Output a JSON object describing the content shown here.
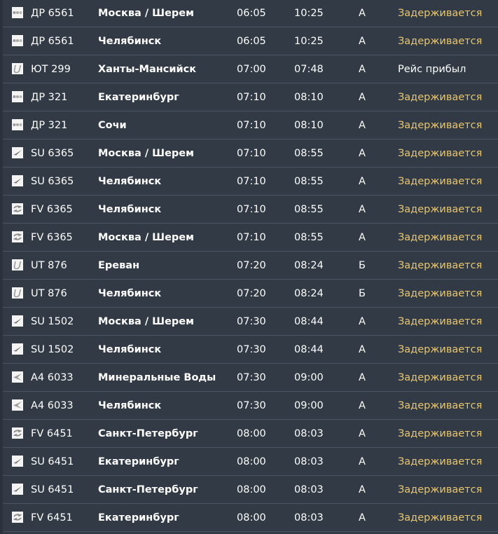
{
  "colors": {
    "background": "#323a45",
    "separator": "#4a5561",
    "text": "#ffffff",
    "status_delayed": "#e8c66e"
  },
  "flights": [
    {
      "airline_icon": "dots-logo-icon",
      "flight": "ДР 6561",
      "destination": "Москва / Шерем",
      "departure": "06:05",
      "arrival": "10:25",
      "terminal": "А",
      "status": "Задерживается",
      "status_type": "delayed"
    },
    {
      "airline_icon": "dots-logo-icon",
      "flight": "ДР 6561",
      "destination": "Челябинск",
      "departure": "06:05",
      "arrival": "10:25",
      "terminal": "А",
      "status": "Задерживается",
      "status_type": "delayed"
    },
    {
      "airline_icon": "u-logo-icon",
      "flight": "ЮТ 299",
      "destination": "Ханты-Мансийск",
      "departure": "07:00",
      "arrival": "07:48",
      "terminal": "А",
      "status": "Рейс прибыл",
      "status_type": "arrived"
    },
    {
      "airline_icon": "dots-logo-icon",
      "flight": "ДР 321",
      "destination": "Екатеринбург",
      "departure": "07:10",
      "arrival": "08:10",
      "terminal": "А",
      "status": "Задерживается",
      "status_type": "delayed"
    },
    {
      "airline_icon": "dots-logo-icon",
      "flight": "ДР 321",
      "destination": "Сочи",
      "departure": "07:10",
      "arrival": "08:10",
      "terminal": "А",
      "status": "Задерживается",
      "status_type": "delayed"
    },
    {
      "airline_icon": "plane-logo-icon",
      "flight": "SU 6365",
      "destination": "Москва / Шерем",
      "departure": "07:10",
      "arrival": "08:55",
      "terminal": "А",
      "status": "Задерживается",
      "status_type": "delayed"
    },
    {
      "airline_icon": "plane-logo-icon",
      "flight": "SU 6365",
      "destination": "Челябинск",
      "departure": "07:10",
      "arrival": "08:55",
      "terminal": "А",
      "status": "Задерживается",
      "status_type": "delayed"
    },
    {
      "airline_icon": "swirl-logo-icon",
      "flight": "FV 6365",
      "destination": "Челябинск",
      "departure": "07:10",
      "arrival": "08:55",
      "terminal": "А",
      "status": "Задерживается",
      "status_type": "delayed"
    },
    {
      "airline_icon": "swirl-logo-icon",
      "flight": "FV 6365",
      "destination": "Москва / Шерем",
      "departure": "07:10",
      "arrival": "08:55",
      "terminal": "А",
      "status": "Задерживается",
      "status_type": "delayed"
    },
    {
      "airline_icon": "u-logo-icon",
      "flight": "UT 876",
      "destination": "Ереван",
      "departure": "07:20",
      "arrival": "08:24",
      "terminal": "Б",
      "status": "Задерживается",
      "status_type": "delayed"
    },
    {
      "airline_icon": "u-logo-icon",
      "flight": "UT 876",
      "destination": "Челябинск",
      "departure": "07:20",
      "arrival": "08:24",
      "terminal": "Б",
      "status": "Задерживается",
      "status_type": "delayed"
    },
    {
      "airline_icon": "plane-logo-icon",
      "flight": "SU 1502",
      "destination": "Москва / Шерем",
      "departure": "07:30",
      "arrival": "08:44",
      "terminal": "А",
      "status": "Задерживается",
      "status_type": "delayed"
    },
    {
      "airline_icon": "plane-logo-icon",
      "flight": "SU 1502",
      "destination": "Челябинск",
      "departure": "07:30",
      "arrival": "08:44",
      "terminal": "А",
      "status": "Задерживается",
      "status_type": "delayed"
    },
    {
      "airline_icon": "wing-logo-icon",
      "flight": "A4 6033",
      "destination": "Минеральные Воды",
      "departure": "07:30",
      "arrival": "09:00",
      "terminal": "А",
      "status": "Задерживается",
      "status_type": "delayed"
    },
    {
      "airline_icon": "wing-logo-icon",
      "flight": "A4 6033",
      "destination": "Челябинск",
      "departure": "07:30",
      "arrival": "09:00",
      "terminal": "А",
      "status": "Задерживается",
      "status_type": "delayed"
    },
    {
      "airline_icon": "swirl-logo-icon",
      "flight": "FV 6451",
      "destination": "Санкт-Петербург",
      "departure": "08:00",
      "arrival": "08:03",
      "terminal": "А",
      "status": "Задерживается",
      "status_type": "delayed"
    },
    {
      "airline_icon": "plane-logo-icon",
      "flight": "SU 6451",
      "destination": "Екатеринбург",
      "departure": "08:00",
      "arrival": "08:03",
      "terminal": "А",
      "status": "Задерживается",
      "status_type": "delayed"
    },
    {
      "airline_icon": "plane-logo-icon",
      "flight": "SU 6451",
      "destination": "Санкт-Петербург",
      "departure": "08:00",
      "arrival": "08:03",
      "terminal": "А",
      "status": "Задерживается",
      "status_type": "delayed"
    },
    {
      "airline_icon": "swirl-logo-icon",
      "flight": "FV 6451",
      "destination": "Екатеринбург",
      "departure": "08:00",
      "arrival": "08:03",
      "terminal": "А",
      "status": "Задерживается",
      "status_type": "delayed"
    }
  ]
}
